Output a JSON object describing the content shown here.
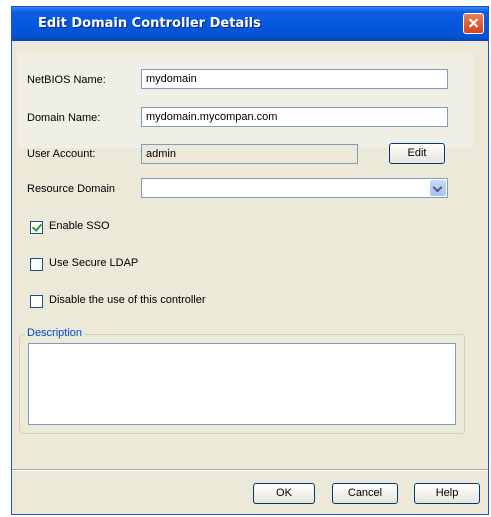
{
  "dialog": {
    "title": "Edit Domain Controller Details"
  },
  "form": {
    "netbios_label": "NetBIOS Name:",
    "netbios_value": "mydomain",
    "domain_label": "Domain Name:",
    "domain_value": "mydomain.mycompan.com",
    "user_label": "User Account:",
    "user_value": "admin",
    "edit_label": "Edit",
    "resource_label": "Resource Domain",
    "resource_value": ""
  },
  "options": {
    "enable_sso": {
      "label": "Enable SSO",
      "checked": true
    },
    "secure_ldap": {
      "label": "Use Secure LDAP",
      "checked": false
    },
    "disable_controller": {
      "label": "Disable the use of this controller",
      "checked": false
    }
  },
  "description": {
    "legend": "Description",
    "value": ""
  },
  "footer": {
    "ok_label": "OK",
    "cancel_label": "Cancel",
    "help_label": "Help"
  },
  "icons": [
    "close-icon",
    "chevron-down-icon",
    "checkmark-icon"
  ]
}
